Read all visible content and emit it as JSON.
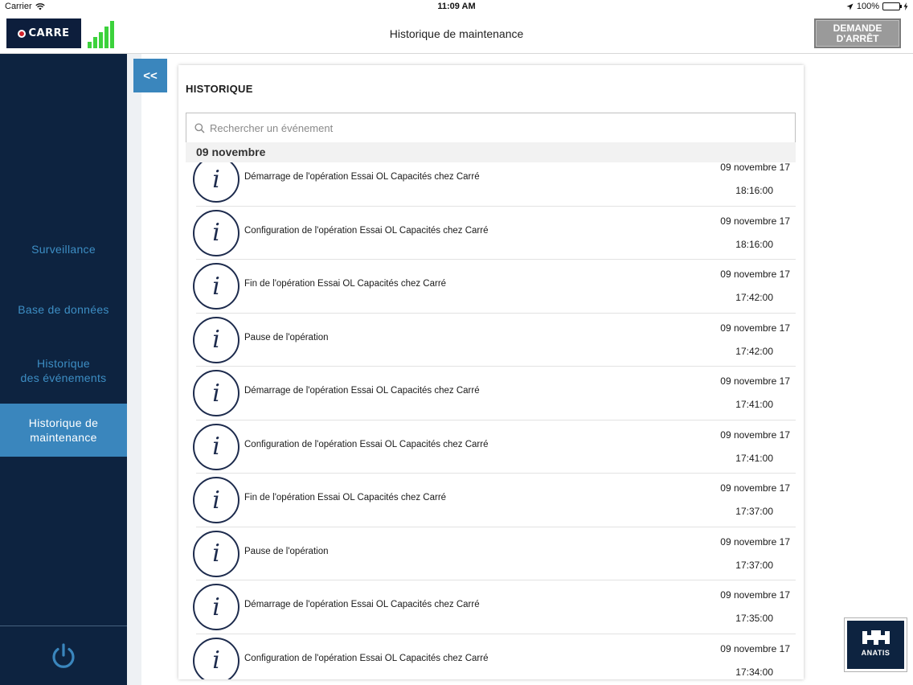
{
  "status_bar": {
    "carrier": "Carrier",
    "time": "11:09 AM",
    "battery": "100%"
  },
  "header": {
    "logo_text": "CARRE",
    "title": "Historique de maintenance",
    "stop_button_line1": "DEMANDE",
    "stop_button_line2": "D'ARRÊT"
  },
  "sidebar": {
    "items": [
      {
        "label_line1": "Surveillance",
        "label_line2": ""
      },
      {
        "label_line1": "Base de données",
        "label_line2": ""
      },
      {
        "label_line1": "Historique",
        "label_line2": "des événements"
      },
      {
        "label_line1": "Historique de",
        "label_line2": "maintenance"
      }
    ],
    "active_index": 3
  },
  "collapse_button": "<<",
  "panel": {
    "title": "HISTORIQUE",
    "search_placeholder": "Rechercher un événement",
    "section_header": "09 novembre",
    "events": [
      {
        "text": "Démarrage de l'opération Essai OL Capacités chez Carré",
        "date": "09 novembre 17",
        "time": "18:16:00"
      },
      {
        "text": "Configuration de l'opération Essai OL Capacités chez Carré",
        "date": "09 novembre 17",
        "time": "18:16:00"
      },
      {
        "text": "Fin de l'opération Essai OL Capacités chez Carré",
        "date": "09 novembre 17",
        "time": "17:42:00"
      },
      {
        "text": "Pause de l'opération",
        "date": "09 novembre 17",
        "time": "17:42:00"
      },
      {
        "text": "Démarrage de l'opération Essai OL Capacités chez Carré",
        "date": "09 novembre 17",
        "time": "17:41:00"
      },
      {
        "text": "Configuration de l'opération Essai OL Capacités chez Carré",
        "date": "09 novembre 17",
        "time": "17:41:00"
      },
      {
        "text": "Fin de l'opération Essai OL Capacités chez Carré",
        "date": "09 novembre 17",
        "time": "17:37:00"
      },
      {
        "text": "Pause de l'opération",
        "date": "09 novembre 17",
        "time": "17:37:00"
      },
      {
        "text": "Démarrage de l'opération Essai OL Capacités chez Carré",
        "date": "09 novembre 17",
        "time": "17:35:00"
      },
      {
        "text": "Configuration de l'opération Essai OL Capacités chez Carré",
        "date": "09 novembre 17",
        "time": "17:34:00"
      }
    ],
    "event_icon": "info-icon"
  },
  "anatis_button": {
    "label": "ANATIS",
    "icon": "machine-icon"
  },
  "colors": {
    "sidebar_bg": "#0d2340",
    "accent": "#3a86bd",
    "nav_text": "#3d8ec4",
    "signal": "#3cd23c",
    "logo_red": "#d2232a"
  }
}
